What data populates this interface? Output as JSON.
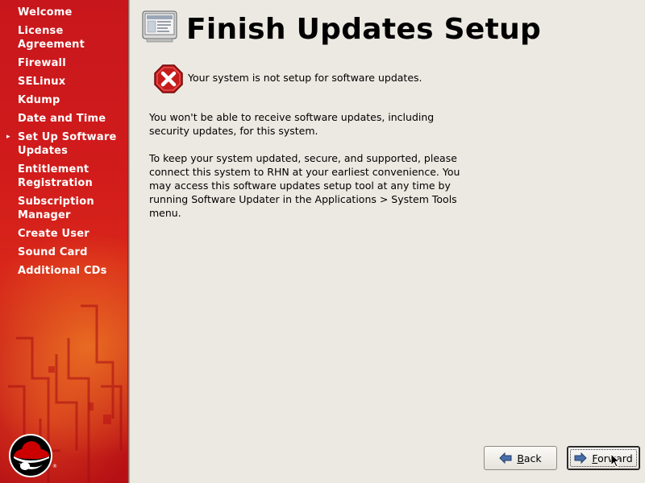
{
  "sidebar": {
    "items": [
      {
        "label": "Welcome",
        "current": false
      },
      {
        "label": "License Agreement",
        "current": false
      },
      {
        "label": "Firewall",
        "current": false
      },
      {
        "label": "SELinux",
        "current": false
      },
      {
        "label": "Kdump",
        "current": false
      },
      {
        "label": "Date and Time",
        "current": false
      },
      {
        "label": "Set Up Software Updates",
        "current": true
      },
      {
        "label": "Entitlement Registration",
        "current": false
      },
      {
        "label": "Subscription Manager",
        "current": false
      },
      {
        "label": "Create User",
        "current": false
      },
      {
        "label": "Sound Card",
        "current": false
      },
      {
        "label": "Additional CDs",
        "current": false
      }
    ],
    "current_marker": "▸",
    "logo_icon": "redhat-shadowman-logo"
  },
  "main": {
    "title": "Finish Updates Setup",
    "header_icon": "computer-window-icon",
    "status_icon": "error-x-octagon-icon",
    "status_text": "Your system is not setup for software updates.",
    "paragraph1": "You won't be able to receive software updates, including security updates, for this system.",
    "paragraph2": "To keep your system updated, secure, and supported, please connect this system to RHN at your earliest convenience. You may access this software updates setup tool at any time by running Software Updater in the Applications > System Tools menu."
  },
  "buttons": {
    "back": {
      "label_pre": "",
      "label_mnemonic": "B",
      "label_post": "ack",
      "icon": "arrow-left-icon"
    },
    "forward": {
      "label_pre": "",
      "label_mnemonic": "F",
      "label_post": "orward",
      "icon": "arrow-right-icon"
    }
  },
  "colors": {
    "sidebar_red": "#c8171c",
    "background": "#ece9e2",
    "error_red": "#cc1d1d"
  }
}
